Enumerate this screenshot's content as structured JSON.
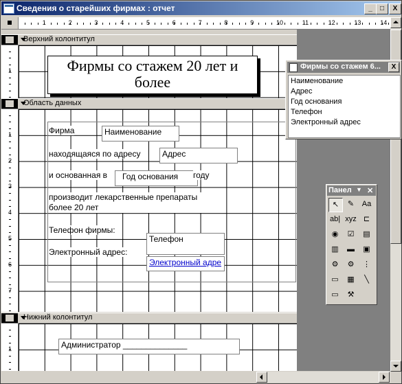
{
  "window": {
    "title": "Сведения о старейших фирмах : отчет",
    "minimize": "_",
    "maximize": "□",
    "close": "X"
  },
  "ruler": {
    "top_numbers": [
      "1",
      "2",
      "3",
      "4",
      "5",
      "6",
      "7",
      "8",
      "9",
      "10",
      "11",
      "12",
      "13",
      "14"
    ],
    "left_header": [
      "1"
    ],
    "left_data": [
      "1",
      "2",
      "3",
      "4",
      "5",
      "6",
      "7"
    ],
    "left_footer": [
      "1"
    ]
  },
  "sections": {
    "header": "Верхний колонтитул",
    "detail": "Область данных",
    "footer": "Нижний колонтитул"
  },
  "report": {
    "title": "Фирмы со стажем 20 лет и более",
    "label_firm": "Фирма",
    "field_name": "Наименование",
    "label_address": "находящаяся по адресу",
    "field_address": "Адрес",
    "label_founded": "и основанная в",
    "field_year": "Год основания",
    "label_year_suffix": "году",
    "label_produces": "производит лекарственные препараты более 20 лет",
    "label_phone": "Телефон фирмы:",
    "field_phone": "Телефон",
    "label_email": "Электронный адрес:",
    "field_email": "Электронный адре",
    "footer_admin": "Администратор ______________"
  },
  "field_list": {
    "title": "Фирмы со стажем 6...",
    "close": "X",
    "items": [
      "Наименование",
      "Адрес",
      "Год основания",
      "Телефон",
      "Электронный адрес"
    ]
  },
  "toolbox": {
    "title": "Панел",
    "dropdown": "▼",
    "close": "✕",
    "tools": [
      {
        "name": "select-tool",
        "glyph": "↖"
      },
      {
        "name": "wizard-tool",
        "glyph": "✎"
      },
      {
        "name": "label-tool",
        "glyph": "Aa"
      },
      {
        "name": "textbox-tool",
        "glyph": "ab|"
      },
      {
        "name": "option-group-tool",
        "glyph": "xyz"
      },
      {
        "name": "toggle-button-tool",
        "glyph": "⊏"
      },
      {
        "name": "option-button-tool",
        "glyph": "◉"
      },
      {
        "name": "checkbox-tool",
        "glyph": "☑"
      },
      {
        "name": "combobox-tool",
        "glyph": "▤"
      },
      {
        "name": "listbox-tool",
        "glyph": "▥"
      },
      {
        "name": "command-button-tool",
        "glyph": "▬"
      },
      {
        "name": "image-tool",
        "glyph": "▣"
      },
      {
        "name": "unbound-frame-tool",
        "glyph": "⚙"
      },
      {
        "name": "bound-frame-tool",
        "glyph": "⚙"
      },
      {
        "name": "page-break-tool",
        "glyph": "⋮"
      },
      {
        "name": "tab-control-tool",
        "glyph": "▭"
      },
      {
        "name": "subform-tool",
        "glyph": "▦"
      },
      {
        "name": "line-tool",
        "glyph": "╲"
      },
      {
        "name": "rectangle-tool",
        "glyph": "▭"
      },
      {
        "name": "more-controls-tool",
        "glyph": "⚒"
      }
    ]
  }
}
